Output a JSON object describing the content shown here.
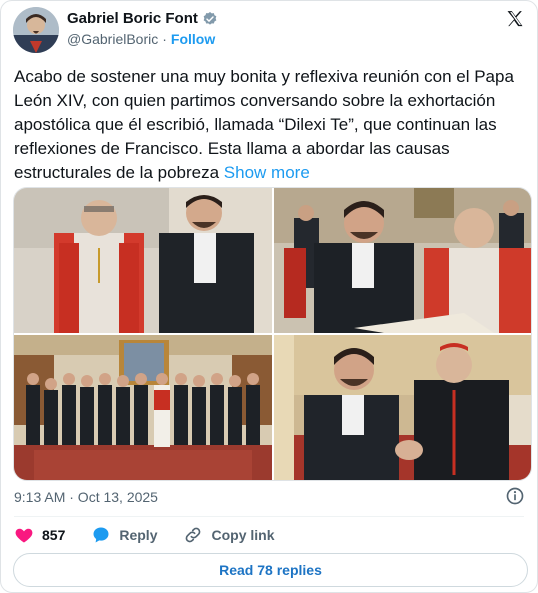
{
  "author": {
    "name": "Gabriel Boric Font",
    "handle": "@GabrielBoric",
    "separator": "·",
    "follow_label": "Follow"
  },
  "tweet": {
    "text": "Acabo de sostener una muy bonita y reflexiva reunión con el Papa León XIV, con quien partimos conversando sobre la exhortación apostólica que él escribió, llamada “Dilexi Te”, que continuan las reflexiones de Francisco. Esta llama a abordar las causas estructurales de la pobreza",
    "show_more_label": "Show more"
  },
  "media": {
    "photos": [
      "photo-1",
      "photo-2",
      "photo-3",
      "photo-4"
    ]
  },
  "meta": {
    "timestamp": "9:13 AM · Oct 13, 2025"
  },
  "actions": {
    "like_count": "857",
    "reply_label": "Reply",
    "copy_link_label": "Copy link"
  },
  "footer": {
    "read_replies_label": "Read 78 replies"
  },
  "colors": {
    "accent": "#1d9bf0",
    "like": "#f91880",
    "text": "#0f1419",
    "muted": "#536471"
  },
  "icons": {
    "verified": "verified-badge-icon",
    "brand": "x-logo-icon",
    "info": "info-icon",
    "like": "heart-icon",
    "reply": "reply-bubble-icon",
    "copy": "link-icon"
  }
}
